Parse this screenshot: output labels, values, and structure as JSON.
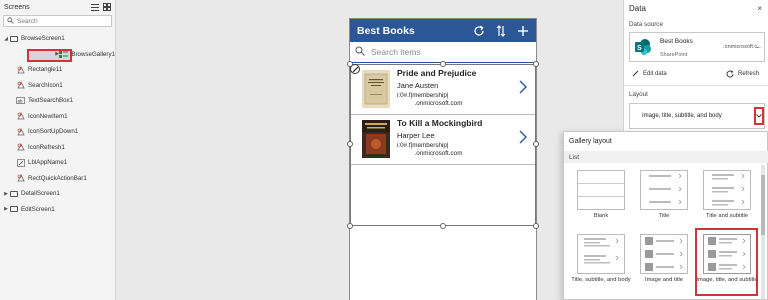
{
  "tree": {
    "title": "Screens",
    "search_placeholder": "Search",
    "items": [
      {
        "label": "BrowseScreen1",
        "level": 0,
        "expanded": true,
        "kind": "screen"
      },
      {
        "label": "BrowseGallery1",
        "level": 1,
        "expanded": false,
        "kind": "gallery",
        "selected": true
      },
      {
        "label": "Rectangle11",
        "level": 1,
        "kind": "rectangle"
      },
      {
        "label": "SearchIcon1",
        "level": 1,
        "kind": "icon"
      },
      {
        "label": "TextSearchBox1",
        "level": 1,
        "kind": "textbox"
      },
      {
        "label": "IconNewItem1",
        "level": 1,
        "kind": "icon"
      },
      {
        "label": "IconSortUpDown1",
        "level": 1,
        "kind": "icon"
      },
      {
        "label": "IconRefresh1",
        "level": 1,
        "kind": "icon"
      },
      {
        "label": "LblAppName1",
        "level": 1,
        "kind": "label"
      },
      {
        "label": "RectQuickActionBar1",
        "level": 1,
        "kind": "rectangle"
      },
      {
        "label": "DetailScreen1",
        "level": 0,
        "expanded": false,
        "kind": "screen"
      },
      {
        "label": "EditScreen1",
        "level": 0,
        "expanded": false,
        "kind": "screen"
      }
    ]
  },
  "app": {
    "title": "Best Books",
    "search_placeholder": "Search items",
    "header_color": "#2b5797",
    "items": [
      {
        "title": "Pride and Prejudice",
        "subtitle": "Jane Austen",
        "body": "i:0#.f|membership|\n          .onmicrosoft.com"
      },
      {
        "title": "To Kill a Mockingbird",
        "subtitle": "Harper Lee",
        "body": "i:0#.f|membership|\n          .onmicrosoft.com"
      }
    ]
  },
  "data_pane": {
    "title": "Data",
    "close": "×",
    "source_label": "Data source",
    "source_name": "Best Books",
    "source_type": "SharePoint",
    "source_account": ".onmicrosoft.c...",
    "edit_data": "Edit data",
    "refresh": "Refresh",
    "layout_label": "Layout",
    "layout_value": "Image, title, subtitle, and body"
  },
  "flyout": {
    "title": "Gallery layout",
    "section": "List",
    "tiles": [
      {
        "label": "Blank"
      },
      {
        "label": "Title"
      },
      {
        "label": "Title and subtitle"
      },
      {
        "label": "Title, subtitle, and body"
      },
      {
        "label": "Image and title"
      },
      {
        "label": "Image, title, and subtitle",
        "selected": true
      }
    ]
  },
  "colors": {
    "selection": "#d13438",
    "accent": "#2b5797"
  }
}
